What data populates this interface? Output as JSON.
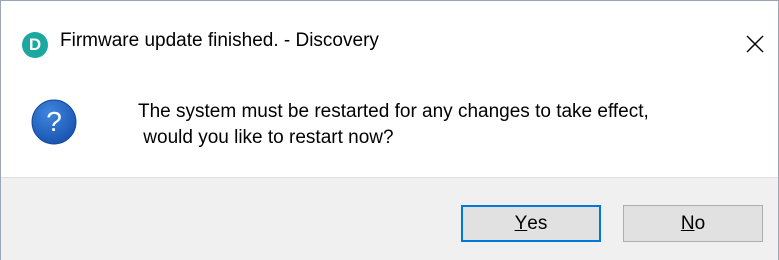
{
  "window": {
    "title": "Firmware update finished. - Discovery",
    "app_icon_letter": "D",
    "app_icon_color": "#1aa8a0",
    "close_icon": "close-icon"
  },
  "message": {
    "icon": "question-icon",
    "icon_color": "#1e5fbf",
    "lines": [
      "The system must be restarted for any changes to take effect,",
      " would you like to restart now?"
    ]
  },
  "buttons": {
    "yes": {
      "accel": "Y",
      "rest": "es",
      "default": true
    },
    "no": {
      "accel": "N",
      "rest": "o",
      "default": false
    }
  },
  "colors": {
    "footer_bg": "#f0f0f0",
    "default_button_border": "#0078d7"
  }
}
